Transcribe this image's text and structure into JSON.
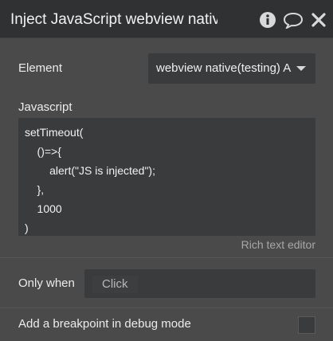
{
  "header": {
    "title": "Inject JavaScript webview native",
    "icons": [
      "info-icon",
      "comment-icon",
      "close-icon"
    ]
  },
  "element": {
    "label": "Element",
    "value": "webview native(testing) A"
  },
  "javascript": {
    "label": "Javascript",
    "code": "setTimeout(\n    ()=>{\n        alert(\"JS is injected\");\n    },\n    1000\n)",
    "rich_text_editor": "Rich text editor"
  },
  "only_when": {
    "label": "Only when",
    "placeholder": "Click"
  },
  "breakpoint": {
    "label": "Add a breakpoint in debug mode",
    "checked": false
  },
  "colors": {
    "header_bg": "#2f3133",
    "panel_bg": "#4a4a4a",
    "field_bg": "#3a3b3d"
  }
}
